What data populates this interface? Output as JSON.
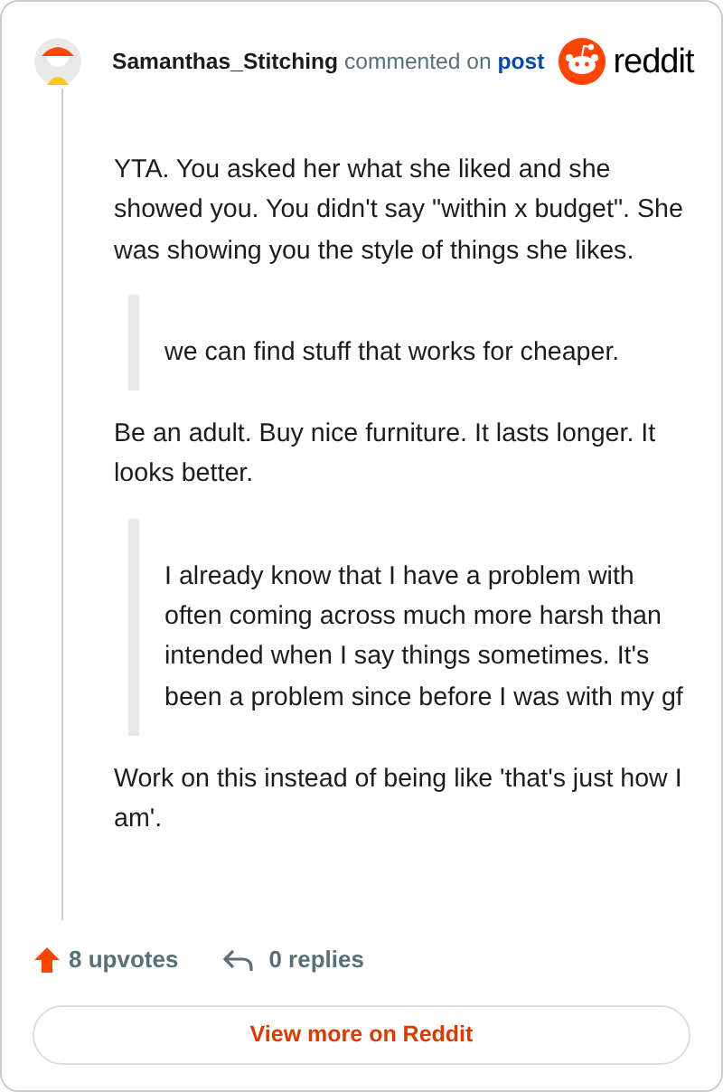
{
  "header": {
    "author": "Samanthas_Stitching",
    "action": "commented on",
    "link": "post",
    "brand": "reddit"
  },
  "body": [
    {
      "kind": "paragraph",
      "text": "YTA. You asked her what she liked and she showed you. You didn't say \"within x budget\". She was showing you the style of things she likes."
    },
    {
      "kind": "quote",
      "text": "we can find stuff that works for cheaper."
    },
    {
      "kind": "paragraph",
      "text": "Be an adult. Buy nice furniture. It lasts longer. It looks better."
    },
    {
      "kind": "quote",
      "text": "I already know that I have a problem with often coming across much more harsh than intended when I say things sometimes. It's been a problem since before I was with my gf"
    },
    {
      "kind": "paragraph",
      "text": "Work on this instead of being like 'that's just how I am'."
    }
  ],
  "footer": {
    "upvotes": "8 upvotes",
    "replies": "0 replies",
    "button": "View more on Reddit"
  }
}
